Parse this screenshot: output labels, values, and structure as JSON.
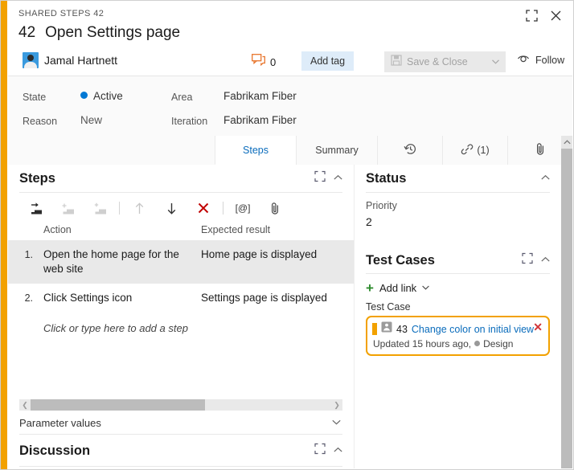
{
  "window": {
    "breadcrumb": "SHARED STEPS 42",
    "maximize_icon": "maximize-icon",
    "close_icon": "close-icon"
  },
  "header": {
    "work_item_id": "42",
    "title": "Open Settings page",
    "assignee": "Jamal Hartnett",
    "comment_count": "0",
    "comment_icon": "comment-icon",
    "add_tag_label": "Add tag",
    "save_close_label": "Save & Close",
    "save_icon": "save-icon",
    "split_chevron": "chevron-down-icon",
    "follow_label": "Follow",
    "follow_icon": "eye-icon",
    "more_label": "•••"
  },
  "fields": [
    {
      "label": "State",
      "value": "Active",
      "has_dot": true,
      "dot_color": "#0078d4"
    },
    {
      "label": "Reason",
      "value": "New",
      "has_dot": false
    },
    {
      "label": "Area",
      "value": "Fabrikam Fiber",
      "has_dot": false
    },
    {
      "label": "Iteration",
      "value": "Fabrikam Fiber",
      "has_dot": false
    }
  ],
  "tabs": [
    {
      "label": "Steps",
      "active": true,
      "kind": "text"
    },
    {
      "label": "Summary",
      "active": false,
      "kind": "text"
    },
    {
      "label": "",
      "active": false,
      "kind": "history-icon"
    },
    {
      "label": "(1)",
      "active": false,
      "kind": "link-icon"
    },
    {
      "label": "",
      "active": false,
      "kind": "attachment-icon"
    }
  ],
  "steps_panel": {
    "title": "Steps",
    "toolbar": [
      {
        "name": "insert-step-icon",
        "enabled": true
      },
      {
        "name": "insert-shared-step-icon",
        "enabled": false
      },
      {
        "name": "add-shared-step-icon",
        "enabled": false
      },
      {
        "name": "move-up-icon",
        "enabled": false
      },
      {
        "name": "move-down-icon",
        "enabled": true
      },
      {
        "name": "delete-step-icon",
        "enabled": true
      },
      {
        "name": "parameter-icon",
        "label": "[@]",
        "enabled": true
      },
      {
        "name": "attachment-icon",
        "enabled": true
      }
    ],
    "columns": {
      "number": "",
      "action": "Action",
      "expected": "Expected result"
    },
    "rows": [
      {
        "num": "1.",
        "action": "Open the home page for the web site",
        "expected": "Home page is displayed",
        "selected": true
      },
      {
        "num": "2.",
        "action": "Click Settings icon",
        "expected": "Settings page is displayed",
        "selected": false
      }
    ],
    "add_step_placeholder": "Click or type here to add a step"
  },
  "parameter_values": {
    "label": "Parameter values",
    "chevron": "chevron-down-icon"
  },
  "discussion": {
    "title": "Discussion"
  },
  "status_panel": {
    "title": "Status",
    "priority_label": "Priority",
    "priority_value": "2"
  },
  "test_cases_panel": {
    "title": "Test Cases",
    "add_link_label": "Add link",
    "group_label": "Test Case",
    "link": {
      "id": "43",
      "title": "Change color on initial view",
      "subtitle_prefix": "Updated 15 hours ago,",
      "state": "Design",
      "highlight_color": "#f2a100",
      "remove_icon": "remove-link-icon"
    }
  },
  "colors": {
    "accent_orange": "#f2a100",
    "link_blue": "#0a6cbc",
    "active_blue": "#0078d4",
    "danger_red": "#d13438",
    "add_green": "#2e8b2e"
  }
}
